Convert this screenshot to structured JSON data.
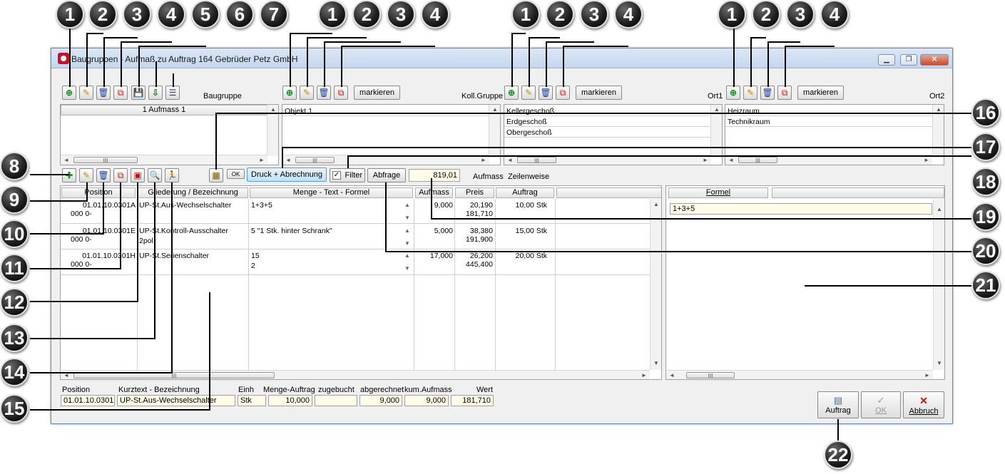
{
  "window": {
    "title": "Baugruppen - Aufmaß zu Auftrag 164 Gebrüder Petz GmbH",
    "min": "▁",
    "max": "❐",
    "close": "✕"
  },
  "toolbar": {
    "baugruppe_label": "Baugruppe",
    "koll_gruppe_label": "Koll.Gruppe",
    "ort1_label": "Ort1",
    "ort2_label": "Ort2",
    "markieren_label": "markieren"
  },
  "lists": {
    "baugruppe": {
      "header": "1 Aufmass 1"
    },
    "koll_gruppe": {
      "items": [
        "Objekt 1"
      ]
    },
    "ort1": {
      "items": [
        "Kellergeschoß",
        "Erdgeschoß",
        "Obergeschoß"
      ]
    },
    "ort2": {
      "items": [
        "Heizraum",
        "Technikraum"
      ]
    }
  },
  "midbar": {
    "ok_label": "OK",
    "druck_label": "Druck + Abrechnung",
    "filter_label": "Filter",
    "abfrage_label": "Abfrage",
    "total_value": "819,01",
    "aufmass_label": "Aufmass",
    "zeilenweise_label": "Zeilenweise"
  },
  "table": {
    "columns": [
      "Position",
      "Gliederung / Bezeichnung",
      "Menge - Text - Formel",
      "Aufmass",
      "Preis",
      "Auftrag"
    ],
    "rows": [
      {
        "pos1": "01.01.10.0301A",
        "pos2": "000 0-",
        "bez1": "UP-St.Aus-Wechselschalter",
        "bez2": "",
        "menge1": "1+3+5",
        "menge2": "",
        "aufmass": "9,000",
        "preis1": "20,190",
        "preis2": "181,710",
        "auftrag": "10,00 Stk"
      },
      {
        "pos1": "01.01.10.0301E",
        "pos2": "000 0-",
        "bez1": "UP-St.Kontroll-Ausschalter",
        "bez2": "2pol",
        "menge1": "5 \"1 Stk. hinter Schrank\"",
        "menge2": "",
        "aufmass": "5,000",
        "preis1": "38,380",
        "preis2": "191,900",
        "auftrag": "15,00 Stk"
      },
      {
        "pos1": "01.01.10.0301H",
        "pos2": "000 0-",
        "bez1": "UP-St.Serienschalter",
        "bez2": "",
        "menge1": "15",
        "menge2": "2",
        "aufmass": "17,000",
        "preis1": "26,200",
        "preis2": "445,400",
        "auftrag": "20,00 Stk"
      }
    ]
  },
  "formel": {
    "header": "Formel",
    "value": "1+3+5"
  },
  "footer": {
    "labels": {
      "position": "Position",
      "kurztext": "Kurztext - Bezeichnung",
      "einh": "Einh",
      "menge_auftrag": "Menge-Auftrag",
      "zugebucht": "zugebucht",
      "abgerechnet": "abgerechnet",
      "kum_aufmass": "kum.Aufmass",
      "wert": "Wert"
    },
    "values": {
      "position": "01.01.10.0301.",
      "kurztext": "UP-St.Aus-Wechselschalter",
      "einh": "Stk",
      "menge_auftrag": "10,000",
      "zugebucht": "",
      "abgerechnet": "9,000",
      "kum_aufmass": "9,000",
      "wert": "181,710"
    }
  },
  "buttons": {
    "auftrag": "Auftrag",
    "ok": "OK",
    "abbruch": "Abbruch"
  },
  "scroll_thumb": "III",
  "callouts": [
    "1",
    "2",
    "3",
    "4",
    "5",
    "6",
    "7",
    "1",
    "2",
    "3",
    "4",
    "1",
    "2",
    "3",
    "4",
    "1",
    "2",
    "3",
    "4",
    "8",
    "9",
    "10",
    "11",
    "12",
    "13",
    "14",
    "15",
    "16",
    "17",
    "18",
    "19",
    "20",
    "21",
    "22"
  ]
}
